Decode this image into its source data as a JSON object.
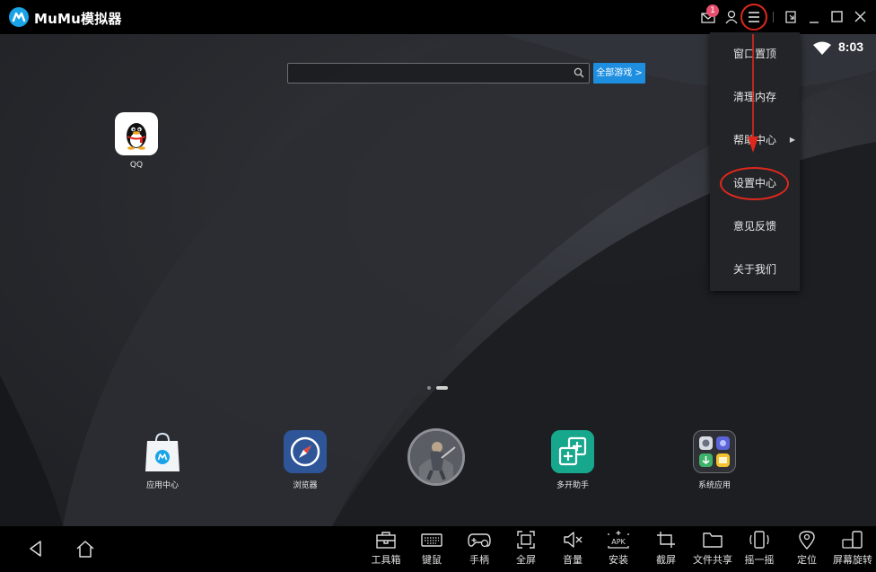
{
  "window": {
    "title": "MuMu模拟器",
    "mail_badge": "1"
  },
  "status": {
    "time": "8:03"
  },
  "search": {
    "placeholder": "",
    "all_games_label": "全部游戏 >"
  },
  "desktop_apps": [
    {
      "label": "QQ"
    }
  ],
  "dock_apps": [
    {
      "label": "应用中心"
    },
    {
      "label": "浏览器"
    },
    {
      "label": ""
    },
    {
      "label": "多开助手"
    },
    {
      "label": "系统应用"
    }
  ],
  "menu": {
    "items": [
      {
        "label": "窗口置顶"
      },
      {
        "label": "清理内存"
      },
      {
        "label": "帮助中心",
        "has_submenu": true
      },
      {
        "label": "设置中心"
      },
      {
        "label": "意见反馈"
      },
      {
        "label": "关于我们"
      }
    ],
    "highlighted_item": "设置中心"
  },
  "toolbar": {
    "items": [
      {
        "label": "工具箱",
        "icon": "toolbox-icon"
      },
      {
        "label": "键鼠",
        "icon": "keyboard-icon"
      },
      {
        "label": "手柄",
        "icon": "gamepad-icon"
      },
      {
        "label": "全屏",
        "icon": "fullscreen-icon"
      },
      {
        "label": "音量",
        "icon": "volume-icon"
      },
      {
        "label": "安装",
        "icon": "apk-install-icon"
      },
      {
        "label": "截屏",
        "icon": "screenshot-crop-icon"
      },
      {
        "label": "文件共享",
        "icon": "folder-icon"
      },
      {
        "label": "摇一摇",
        "icon": "shake-phone-icon"
      },
      {
        "label": "定位",
        "icon": "location-pin-icon"
      },
      {
        "label": "屏幕旋转",
        "icon": "rotate-screen-icon"
      }
    ]
  },
  "colors": {
    "accent_blue": "#1e8fe0",
    "annotation_red": "#e0281c",
    "badge_pink": "#e84f6f"
  }
}
